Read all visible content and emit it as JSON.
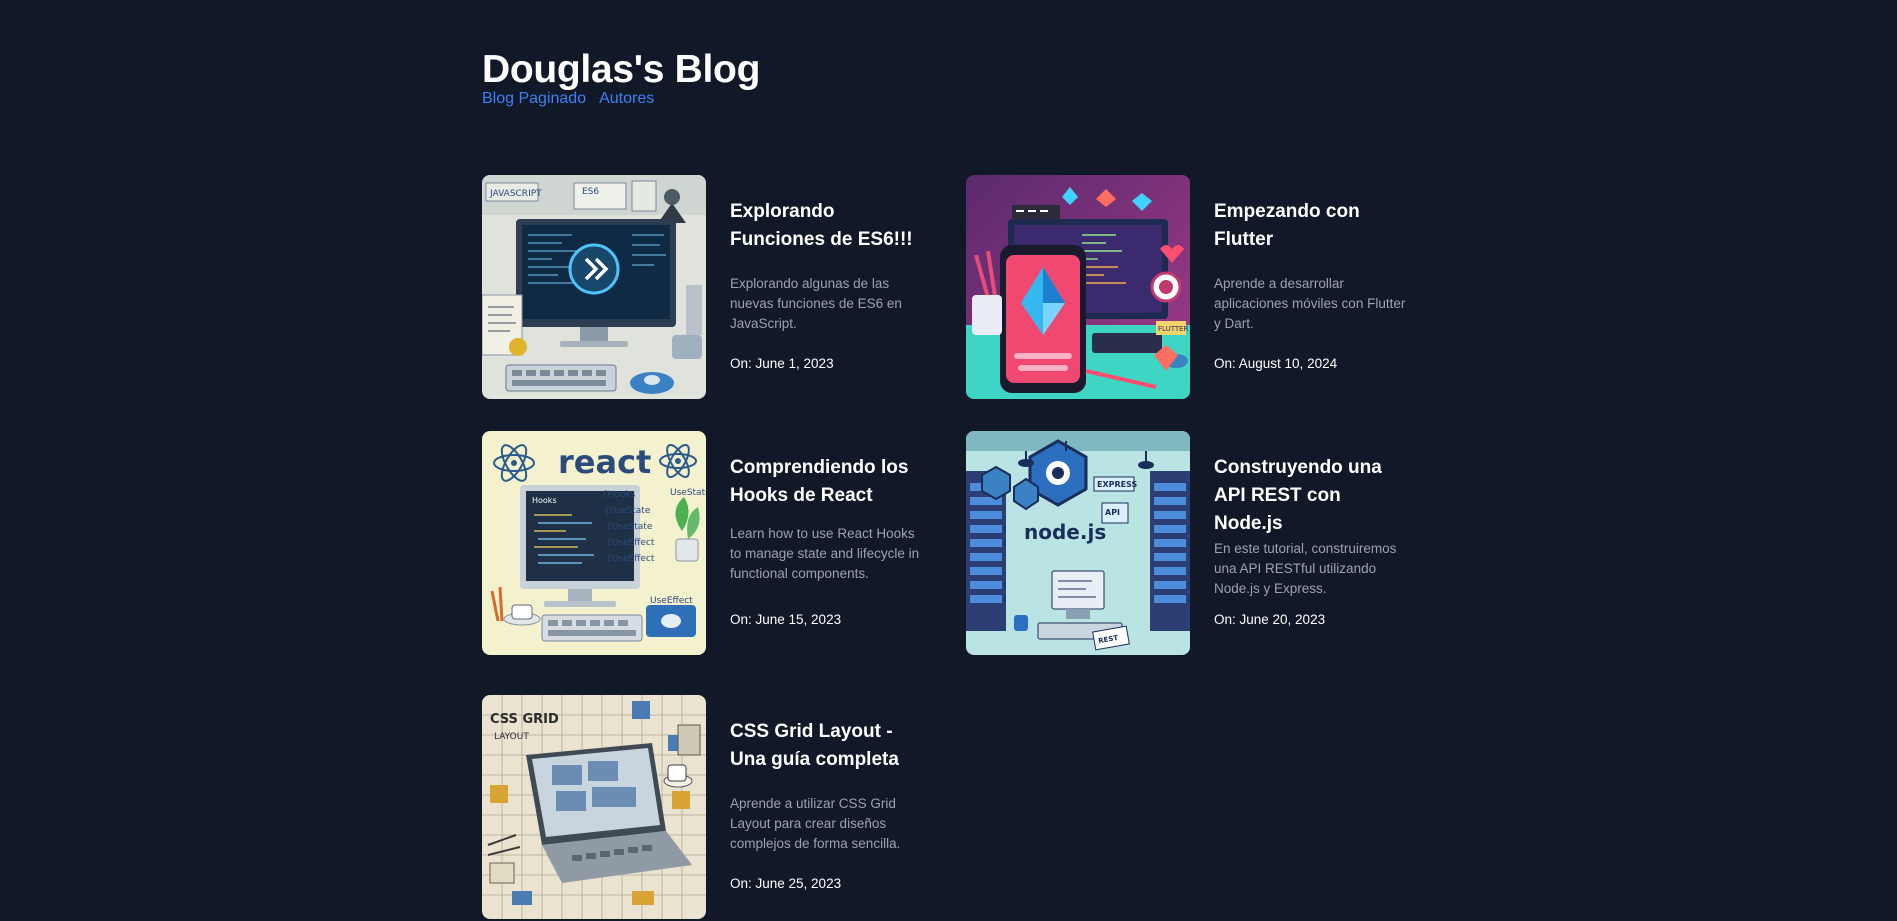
{
  "site": {
    "title": "Douglas's Blog",
    "nav": [
      {
        "label": "Blog Paginado"
      },
      {
        "label": "Autores"
      }
    ]
  },
  "posts": [
    {
      "title": "Explorando Funciones de ES6!!!",
      "description": "Explorando algunas de las nuevas funciones de ES6 en JavaScript.",
      "date": "On: June 1, 2023",
      "image_labels": [
        "JAVASCRIPT",
        "ES6"
      ]
    },
    {
      "title": "Empezando con Flutter",
      "description": "Aprende a desarrollar aplicaciones móviles con Flutter y Dart.",
      "date": "On: August 10, 2024",
      "image_labels": [
        "FLUTTER"
      ]
    },
    {
      "title": "Comprendiendo los Hooks de React",
      "description": "Learn how to use React Hooks to manage state and lifecycle in functional components.",
      "date": "On: June 15, 2023",
      "image_labels": [
        "react",
        "Hooks",
        "UseState",
        "UseEffect"
      ]
    },
    {
      "title": "Construyendo una API REST con Node.js",
      "description": "En este tutorial, construiremos una API RESTful utilizando Node.js y Express.",
      "date": "On: June 20, 2023",
      "image_labels": [
        "node.js",
        "EXPRESS",
        "API",
        "REST"
      ]
    },
    {
      "title": "CSS Grid Layout - Una guía completa",
      "description": "Aprende a utilizar CSS Grid Layout para crear diseños complejos de forma sencilla.",
      "date": "On: June 25, 2023",
      "image_labels": [
        "CSS GRID",
        "LAYOUT"
      ]
    }
  ],
  "colors": {
    "background": "#111827",
    "link": "#3b82f6",
    "muted_text": "#9ca3af"
  }
}
